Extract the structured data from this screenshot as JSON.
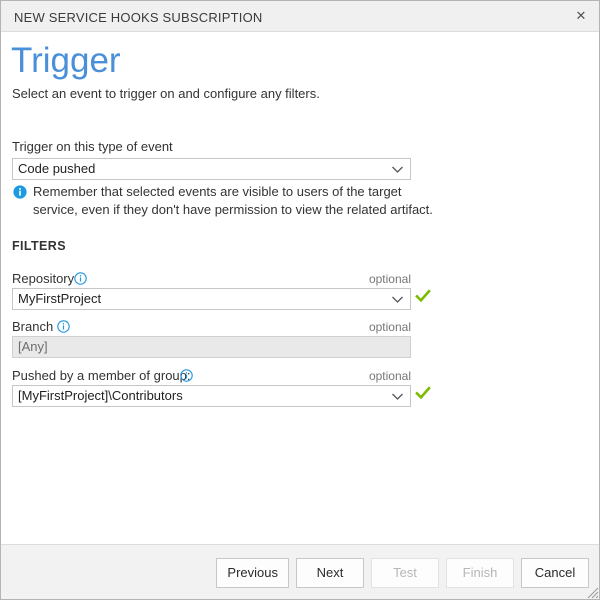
{
  "window": {
    "title": "NEW SERVICE HOOKS SUBSCRIPTION",
    "close_icon": "close-icon",
    "close_glyph": "✕"
  },
  "page": {
    "heading": "Trigger",
    "subheading": "Select an event to trigger on and configure any filters.",
    "heading_color": "#4a90d9"
  },
  "event": {
    "label": "Trigger on this type of event",
    "value": "Code pushed",
    "options": [
      "Code pushed"
    ]
  },
  "notice": {
    "icon": "info-filled-icon",
    "text": "Remember that selected events are visible to users of the target service, even if they don't have permission to view the related artifact."
  },
  "filters": {
    "section_title": "FILTERS",
    "optional_tag": "optional",
    "fields": [
      {
        "label": "Repository",
        "info_icon": "info-outline-icon",
        "value": "MyFirstProject",
        "optional": "optional",
        "disabled": false,
        "valid_icon": "green-check-icon"
      },
      {
        "label": "Branch",
        "info_icon": "info-outline-icon",
        "value": "[Any]",
        "optional": "optional",
        "disabled": true,
        "valid_icon": ""
      },
      {
        "label": "Pushed by a member of group:",
        "info_icon": "info-outline-icon",
        "value": "[MyFirstProject]\\Contributors",
        "optional": "optional",
        "disabled": false,
        "valid_icon": "green-check-icon"
      }
    ]
  },
  "footer": {
    "buttons": [
      {
        "label": "Previous",
        "disabled": false
      },
      {
        "label": "Next",
        "disabled": false
      },
      {
        "label": "Test",
        "disabled": true
      },
      {
        "label": "Finish",
        "disabled": true
      },
      {
        "label": "Cancel",
        "disabled": false
      }
    ],
    "resize_grip_icon": "resize-grip-icon"
  },
  "colors": {
    "accent": "#4a90d9",
    "info": "#0078d7",
    "success": "#7cbb00",
    "titlebar_bg": "#f0f0f0",
    "footer_bg": "#f2f2f2"
  }
}
